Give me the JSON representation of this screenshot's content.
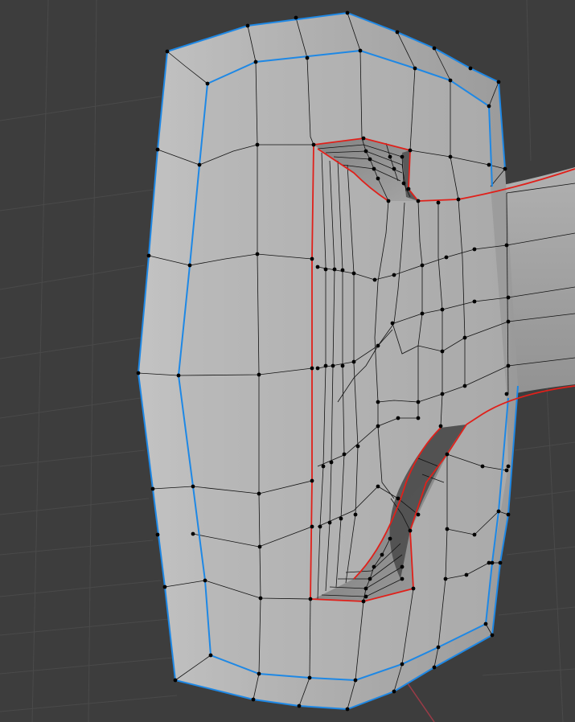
{
  "viewport": {
    "background_color": "#3d3d3d",
    "grid_color": "#4a4a4a",
    "x_axis_color": "#9a3b47"
  },
  "model": {
    "base_color": "#a8a8a8",
    "wire_color": "#111111",
    "selected_loop_color": "#1e88e5",
    "seam_color": "#e0201a"
  }
}
